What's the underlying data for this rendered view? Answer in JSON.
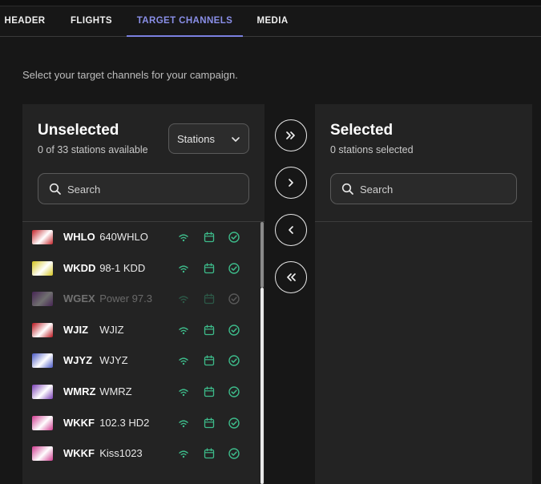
{
  "tabs": [
    {
      "label": "HEADER"
    },
    {
      "label": "FLIGHTS"
    },
    {
      "label": "TARGET CHANNELS",
      "active": true
    },
    {
      "label": "MEDIA"
    }
  ],
  "intro": "Select your target channels for your campaign.",
  "unselected": {
    "title": "Unselected",
    "subtitle": "0 of 33 stations available",
    "filter_value": "Stations",
    "search_placeholder": "Search",
    "stations": [
      {
        "call": "WHLO",
        "name": "640WHLO",
        "logo_color": "#c2242a",
        "enabled": true
      },
      {
        "call": "WKDD",
        "name": "98-1 KDD",
        "logo_color": "#d4c41e",
        "enabled": true
      },
      {
        "call": "WGEX",
        "name": "Power 97.3",
        "logo_color": "#8a2bb0",
        "enabled": false
      },
      {
        "call": "WJIZ",
        "name": "WJIZ",
        "logo_color": "#b8151d",
        "enabled": true
      },
      {
        "call": "WJYZ",
        "name": "WJYZ",
        "logo_color": "#4a59c4",
        "enabled": true
      },
      {
        "call": "WMRZ",
        "name": "WMRZ",
        "logo_color": "#7a3fb5",
        "enabled": true
      },
      {
        "call": "WKKF",
        "name": "102.3 HD2",
        "logo_color": "#cf3a8f",
        "enabled": true
      },
      {
        "call": "WKKF",
        "name": "Kiss1023",
        "logo_color": "#cf3a8f",
        "enabled": true
      }
    ]
  },
  "selected": {
    "title": "Selected",
    "subtitle": "0 stations selected",
    "search_placeholder": "Search"
  },
  "controls": {
    "move_all_right": "chevrons-right-icon",
    "move_right": "chevron-right-icon",
    "move_left": "chevron-left-icon",
    "move_all_left": "chevrons-left-icon"
  },
  "colors": {
    "accent": "#7b80e0",
    "status_icon": "#3dbb8a",
    "panel": "#232323",
    "background": "#171717"
  }
}
